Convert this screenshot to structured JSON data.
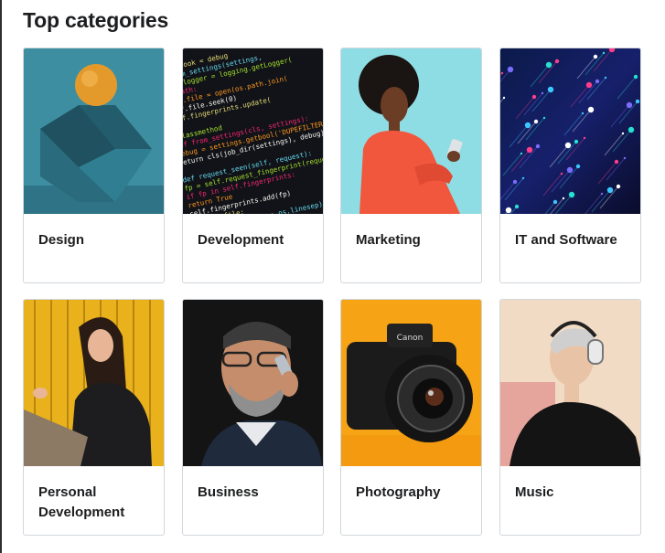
{
  "page": {
    "title": "Top categories"
  },
  "categories": [
    {
      "label": "Design"
    },
    {
      "label": "Development"
    },
    {
      "label": "Marketing"
    },
    {
      "label": "IT and Software"
    },
    {
      "label": "Personal Development"
    },
    {
      "label": "Business"
    },
    {
      "label": "Photography"
    },
    {
      "label": "Music"
    }
  ],
  "images": {
    "development_code_lines": [
      "# logbook = debug",
      "# from_settings(settings,",
      "self.logger = logging.getLogger(",
      "if path:",
      "  self.file = open(os.path.join(",
      "  self.file.seek(0)",
      "  self.fingerprints.update(",
      "",
      "@classmethod",
      "def from_settings(cls, settings):",
      "  debug = settings.getbool('DUPEFILTER_DEBUG')",
      "  return cls(job_dir(settings), debug)",
      "",
      "def request_seen(self, request):",
      "  fp = self.request_fingerprint(request)",
      "  if fp in self.fingerprints:",
      "    return True",
      "  self.fingerprints.add(fp)",
      "  if self.file:",
      "    self.file.write(fp + os.linesep)",
      "",
      "def request_fingerprint(self, request):"
    ],
    "camera_brand": "Canon"
  }
}
